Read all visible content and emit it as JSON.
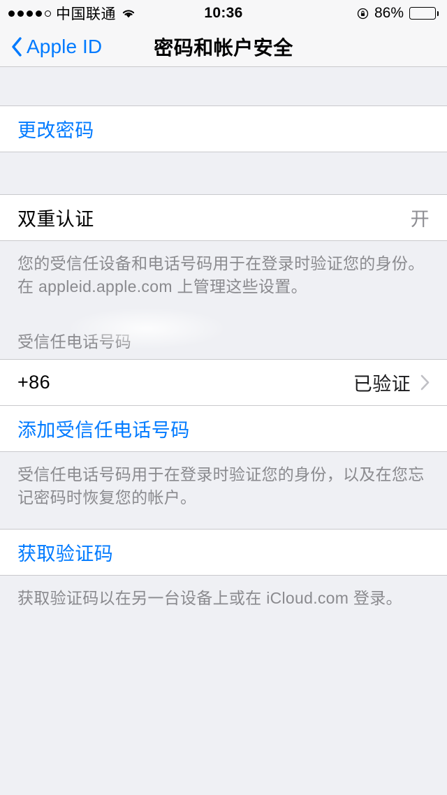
{
  "status_bar": {
    "signal_dots_filled": 4,
    "signal_dots_total": 5,
    "carrier": "中国联通",
    "wifi_icon": "wifi-icon",
    "time": "10:36",
    "rotation_lock_icon": "rotation-lock-icon",
    "battery_percent": "86%",
    "battery_level": 86
  },
  "nav": {
    "back_icon": "chevron-left-icon",
    "back_label": "Apple ID",
    "title": "密码和帐户安全"
  },
  "sections": {
    "password": {
      "change_password_label": "更改密码"
    },
    "two_factor": {
      "title": "双重认证",
      "value": "开",
      "footer": "您的受信任设备和电话号码用于在登录时验证您的身份。在 appleid.apple.com 上管理这些设置。"
    },
    "trusted_numbers": {
      "header": "受信任电话号码",
      "rows": [
        {
          "title": "+86",
          "value": "已验证",
          "chevron_icon": "chevron-right-icon"
        }
      ],
      "add_label": "添加受信任电话号码",
      "footer": "受信任电话号码用于在登录时验证您的身份，以及在您忘记密码时恢复您的帐户。"
    },
    "verification_code": {
      "label": "获取验证码",
      "footer": "获取验证码以在另一台设备上或在 iCloud.com 登录。"
    }
  },
  "colors": {
    "accent": "#007aff",
    "background": "#eff0f4",
    "row_background": "#ffffff",
    "secondary_text": "#8a8a8e",
    "separator": "#c9c9cc"
  }
}
